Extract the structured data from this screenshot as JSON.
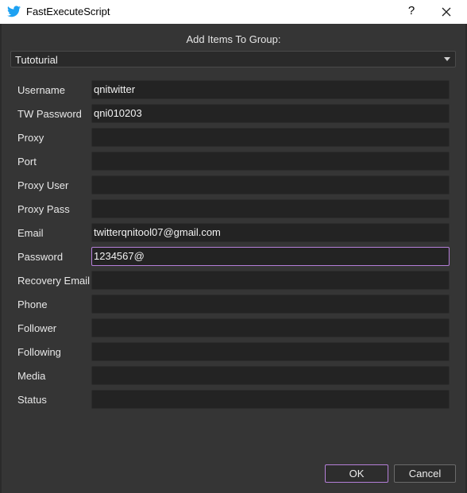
{
  "window": {
    "title": "FastExecuteScript",
    "help_glyph": "?",
    "icon": "twitter-bird-icon",
    "accent_color": "#b57fd9"
  },
  "heading": "Add Items To Group:",
  "group_select": {
    "value": "Tutoturial"
  },
  "form": [
    {
      "label": "Username",
      "value": "qnitwitter"
    },
    {
      "label": "TW Password",
      "value": "qni010203"
    },
    {
      "label": "Proxy",
      "value": ""
    },
    {
      "label": "Port",
      "value": ""
    },
    {
      "label": "Proxy User",
      "value": ""
    },
    {
      "label": "Proxy Pass",
      "value": ""
    },
    {
      "label": "Email",
      "value": "twitterqnitool07@gmail.com"
    },
    {
      "label": "Password",
      "value": "1234567@",
      "focused": true
    },
    {
      "label": "Recovery Email",
      "value": ""
    },
    {
      "label": "Phone",
      "value": ""
    },
    {
      "label": "Follower",
      "value": ""
    },
    {
      "label": "Following",
      "value": ""
    },
    {
      "label": "Media",
      "value": ""
    },
    {
      "label": "Status",
      "value": ""
    }
  ],
  "buttons": {
    "ok": "OK",
    "cancel": "Cancel"
  }
}
